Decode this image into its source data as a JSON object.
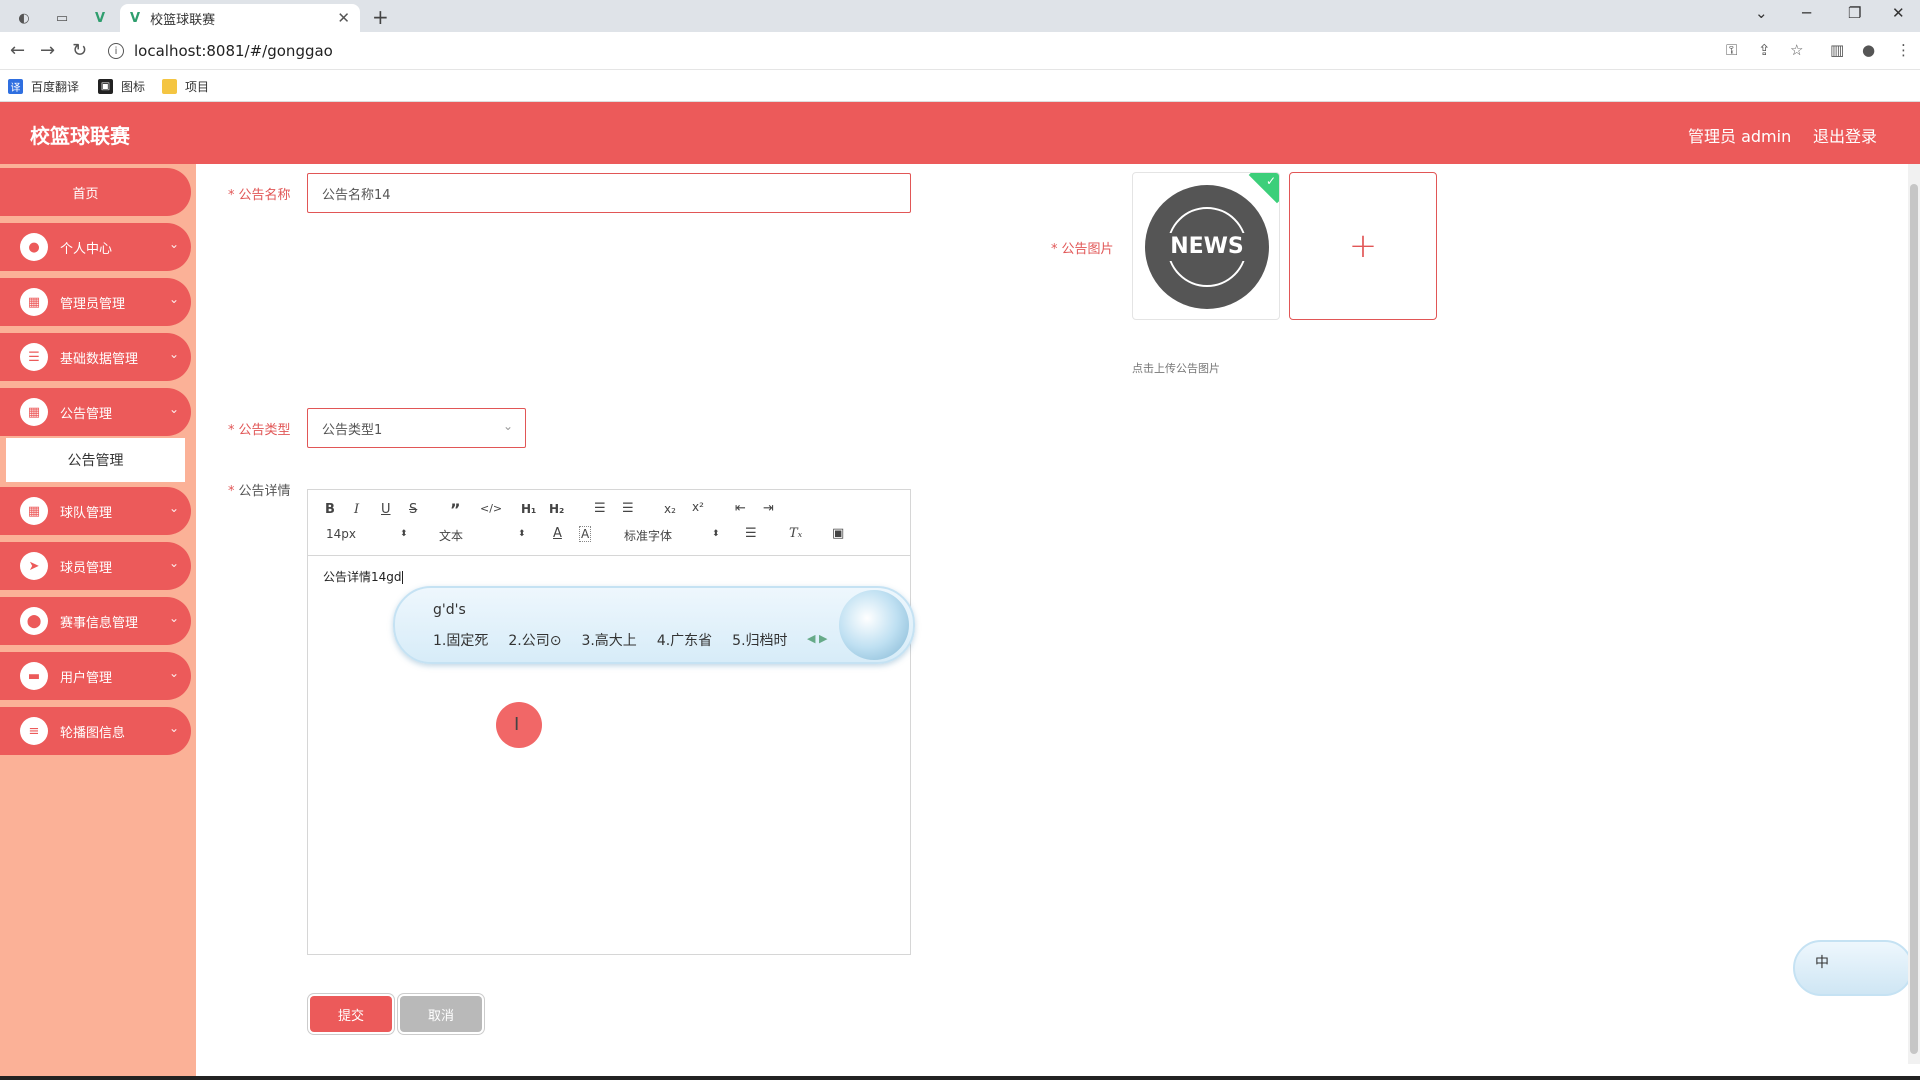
{
  "browser": {
    "tab_title": "校篮球联赛",
    "url": "localhost:8081/#/gonggao",
    "bookmarks": [
      {
        "label": "百度翻译"
      },
      {
        "label": "图标"
      },
      {
        "label": "项目"
      }
    ]
  },
  "header": {
    "title": "校篮球联赛",
    "admin_label": "管理员 admin",
    "logout_label": "退出登录"
  },
  "sidebar": {
    "home": "首页",
    "items": [
      {
        "label": "个人中心"
      },
      {
        "label": "管理员管理"
      },
      {
        "label": "基础数据管理"
      },
      {
        "label": "公告管理"
      },
      {
        "label": "球队管理"
      },
      {
        "label": "球员管理"
      },
      {
        "label": "赛事信息管理"
      },
      {
        "label": "用户管理"
      },
      {
        "label": "轮播图信息"
      }
    ],
    "submenu_active": "公告管理"
  },
  "form": {
    "name_label": "公告名称",
    "name_value": "公告名称14",
    "image_label": "公告图片",
    "image_tip": "点击上传公告图片",
    "image_text": "NEWS",
    "type_label": "公告类型",
    "type_value": "公告类型1",
    "detail_label": "公告详情",
    "detail_value": "公告详情14gd",
    "submit_label": "提交",
    "cancel_label": "取消"
  },
  "editor": {
    "font_size": "14px",
    "block_format": "文本",
    "font_family": "标准字体"
  },
  "ime": {
    "composition": "g'd's",
    "candidates": [
      "1.固定死",
      "2.公司⊙",
      "3.高大上",
      "4.广东省",
      "5.归档时"
    ],
    "status_label": "中"
  },
  "colors": {
    "primary": "#ec5a5a",
    "sidebar_bg": "#fbb197",
    "success": "#3ccf7a"
  }
}
